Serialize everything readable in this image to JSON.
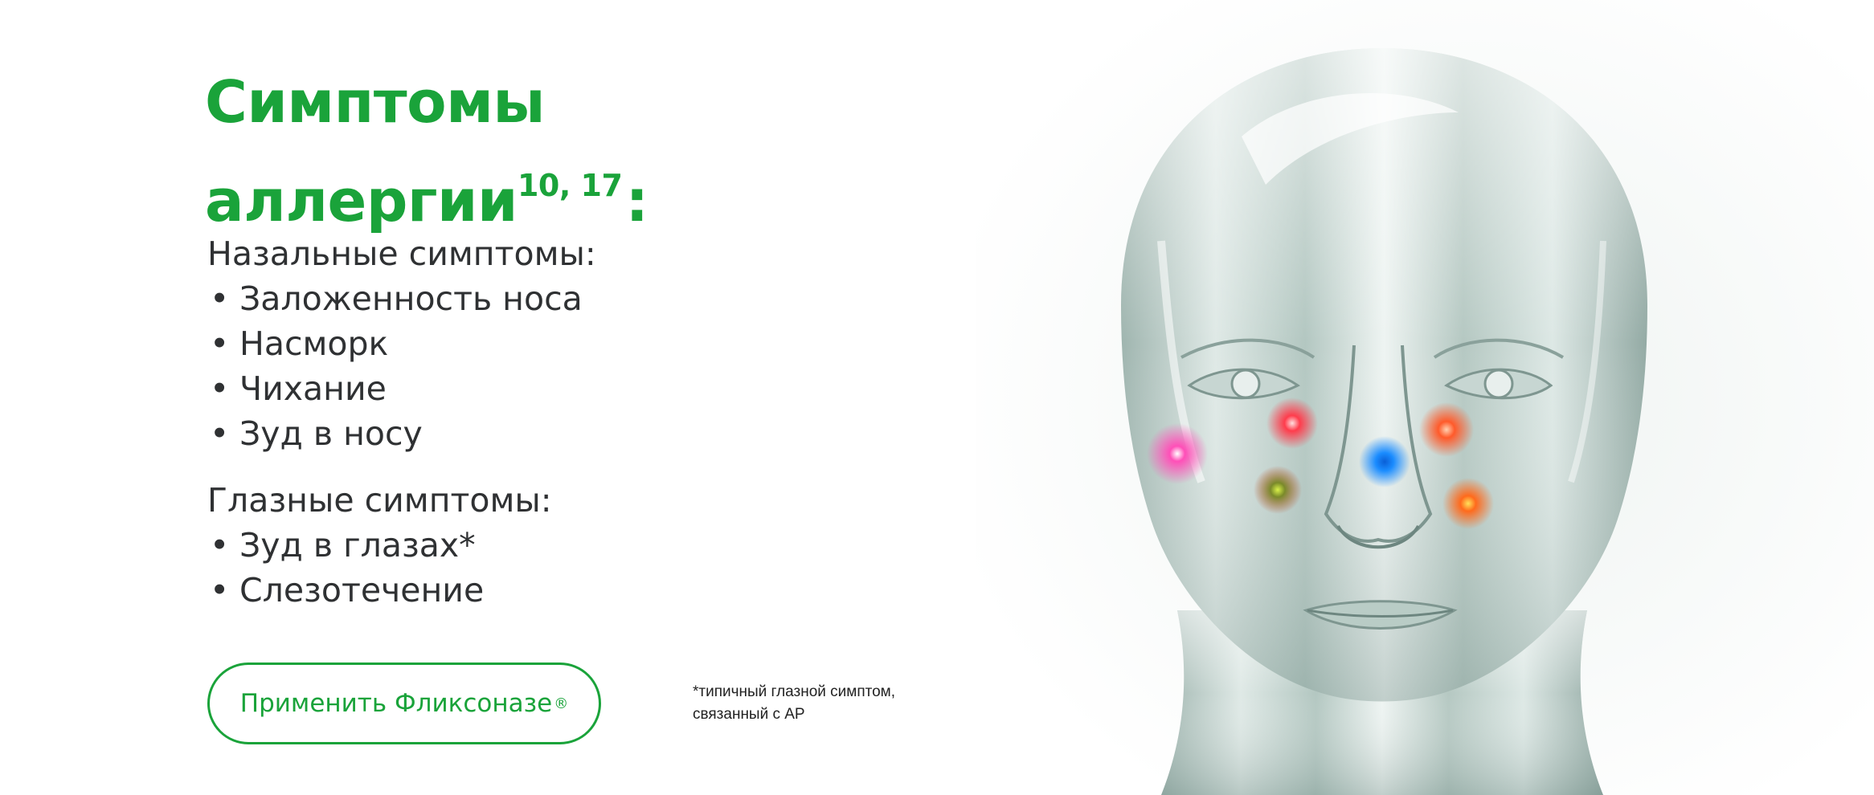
{
  "heading": {
    "line1": "Симптомы",
    "line2": "аллергии",
    "refs": "10, 17",
    "colon": ":"
  },
  "nasal": {
    "heading": "Назальные симптомы:",
    "bullet": "•",
    "items": [
      "Заложенность носа",
      "Насморк",
      "Чихание",
      "Зуд в носу"
    ]
  },
  "ocular": {
    "heading": "Глазные симптомы:",
    "bullet": "•",
    "items": [
      "Зуд в глазах*",
      "Слезотечение"
    ]
  },
  "cta": {
    "label": "Применить Фликсоназе",
    "mark": "®"
  },
  "footnote": {
    "line1": "*типичный глазной симптом,",
    "line2": "связанный с АР"
  },
  "colors": {
    "brand_green": "#1aa33a",
    "text_dark": "#2f3133",
    "spot_pink": "#ff4fb8",
    "spot_red": "#ff3c4c",
    "spot_blue": "#1a8cff",
    "spot_orange": "#ff5a2a",
    "spot_yellow_green": "#b8d83a"
  },
  "illustration": {
    "subject": "glass-head-icon"
  }
}
